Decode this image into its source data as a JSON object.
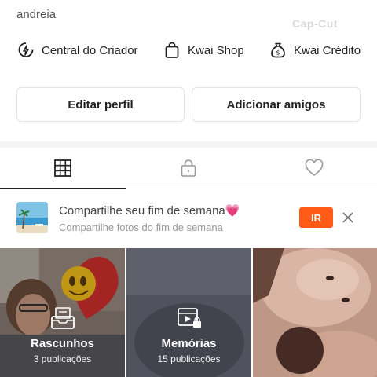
{
  "profile": {
    "username": "andreia"
  },
  "watermark": "Cap-Cut",
  "shortcuts": [
    {
      "icon": "lightning-circle-icon",
      "label": "Central do Criador"
    },
    {
      "icon": "shopping-bag-icon",
      "label": "Kwai Shop"
    },
    {
      "icon": "money-bag-icon",
      "label": "Kwai Crédito"
    }
  ],
  "actions": {
    "edit_label": "Editar perfil",
    "add_friends_label": "Adicionar amigos"
  },
  "tabs": [
    {
      "icon": "grid-icon",
      "active": true
    },
    {
      "icon": "lock-icon",
      "active": false
    },
    {
      "icon": "heart-icon",
      "active": false
    }
  ],
  "banner": {
    "title": "Compartilhe seu fim de semana💗",
    "subtitle": "Compartilhe fotos do fim de semana",
    "button_label": "IR",
    "accent": "#ff5a16"
  },
  "grid": [
    {
      "title": "Rascunhos",
      "count": "3 publicações",
      "icon": "drafts-inbox-icon"
    },
    {
      "title": "Memórias",
      "count": "15 publicações",
      "icon": "memories-video-lock-icon"
    },
    {
      "title": "",
      "count": "",
      "icon": ""
    }
  ]
}
